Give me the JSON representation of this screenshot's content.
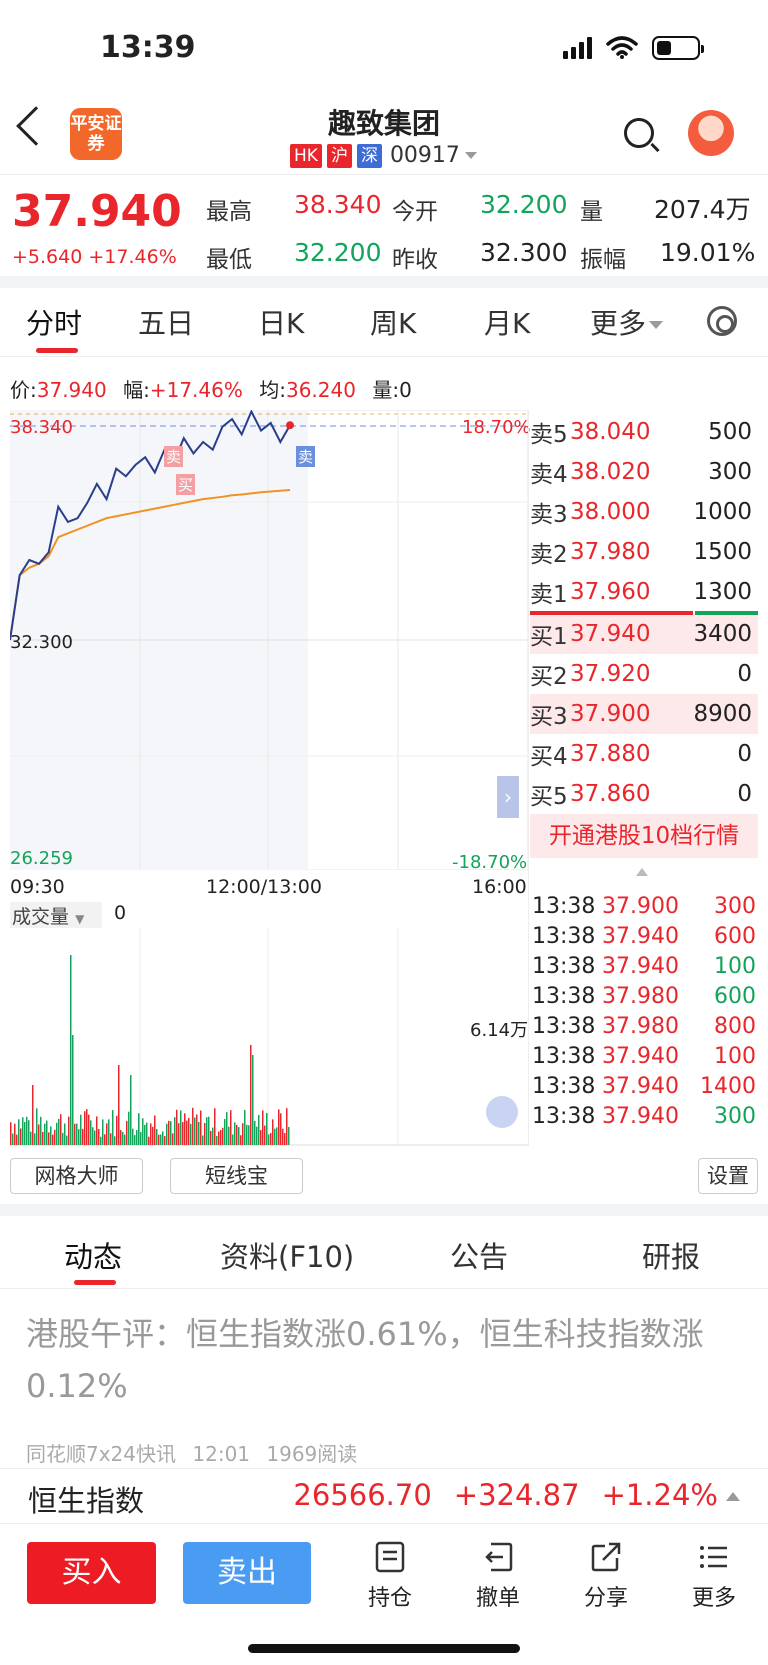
{
  "status": {
    "time": "13:39"
  },
  "header": {
    "logo_text": "平安证券",
    "title": "趣致集团",
    "tags": [
      "HK",
      "沪",
      "深"
    ],
    "code": "00917"
  },
  "quote": {
    "price": "37.940",
    "change": "+5.640",
    "change_pct": "+17.46%",
    "high_label": "最高",
    "high": "38.340",
    "open_label": "今开",
    "open": "32.200",
    "vol_label": "量",
    "vol": "207.4万",
    "low_label": "最低",
    "low": "32.200",
    "prev_close_label": "昨收",
    "prev_close": "32.300",
    "amp_label": "振幅",
    "amp": "19.01%"
  },
  "chart_tabs": [
    "分时",
    "五日",
    "日K",
    "周K",
    "月K",
    "更多"
  ],
  "infoline": {
    "price_label": "价:",
    "price": "37.940",
    "pct_label": "幅:",
    "pct": "+17.46%",
    "avg_label": "均:",
    "avg": "36.240",
    "vol_label": "量:",
    "vol": "0"
  },
  "chart_labels": {
    "top_left": "38.340",
    "top_right": "18.70%",
    "mid_left": "32.300",
    "bottom_left": "26.259",
    "bottom_right": "-18.70%",
    "x_start": "09:30",
    "x_mid": "12:00/13:00",
    "x_end": "16:00",
    "sell_marker": "卖",
    "buy_marker": "买",
    "volume_label": "成交量",
    "volume_value": "0",
    "volume_max": "6.14万"
  },
  "chart_data": {
    "type": "line",
    "x_range": [
      "09:30",
      "16:00"
    ],
    "ylim": [
      26.259,
      38.34
    ],
    "series": [
      {
        "values": [
          32.3,
          34.0,
          34.4,
          34.3,
          34.6,
          35.8,
          35.4,
          35.5,
          35.9,
          36.4,
          36.0,
          36.8,
          36.6,
          36.9,
          37.1,
          36.7,
          37.3,
          37.0,
          37.6,
          37.2,
          37.5,
          37.3,
          37.9,
          38.1,
          37.7,
          38.3,
          37.8,
          38.0,
          37.5,
          37.94
        ]
      },
      {
        "values": [
          32.3,
          34.0,
          34.2,
          34.3,
          34.5,
          35.0,
          35.1,
          35.2,
          35.3,
          35.4,
          35.5,
          35.55,
          35.6,
          35.65,
          35.7,
          35.75,
          35.8,
          35.85,
          35.9,
          35.95,
          36.0,
          36.03,
          36.06,
          36.1,
          36.12,
          36.15,
          36.18,
          36.2,
          36.22,
          36.24
        ]
      }
    ],
    "volume_max": "6.14万"
  },
  "order_book": {
    "asks": [
      {
        "label": "卖5",
        "price": "38.040",
        "vol": "500"
      },
      {
        "label": "卖4",
        "price": "38.020",
        "vol": "300"
      },
      {
        "label": "卖3",
        "price": "38.000",
        "vol": "1000"
      },
      {
        "label": "卖2",
        "price": "37.980",
        "vol": "1500"
      },
      {
        "label": "卖1",
        "price": "37.960",
        "vol": "1300"
      }
    ],
    "bids": [
      {
        "label": "买1",
        "price": "37.940",
        "vol": "3400"
      },
      {
        "label": "买2",
        "price": "37.920",
        "vol": "0"
      },
      {
        "label": "买3",
        "price": "37.900",
        "vol": "8900"
      },
      {
        "label": "买4",
        "price": "37.880",
        "vol": "0"
      },
      {
        "label": "买5",
        "price": "37.860",
        "vol": "0"
      }
    ],
    "promo": "开通港股10档行情"
  },
  "trades": [
    {
      "time": "13:38",
      "price": "37.900",
      "vol": "300",
      "side": "red"
    },
    {
      "time": "13:38",
      "price": "37.940",
      "vol": "600",
      "side": "red"
    },
    {
      "time": "13:38",
      "price": "37.940",
      "vol": "100",
      "side": "green"
    },
    {
      "time": "13:38",
      "price": "37.980",
      "vol": "600",
      "side": "green"
    },
    {
      "time": "13:38",
      "price": "37.980",
      "vol": "800",
      "side": "red"
    },
    {
      "time": "13:38",
      "price": "37.940",
      "vol": "100",
      "side": "red"
    },
    {
      "time": "13:38",
      "price": "37.940",
      "vol": "1400",
      "side": "red"
    },
    {
      "time": "13:38",
      "price": "37.940",
      "vol": "300",
      "side": "green"
    }
  ],
  "tools": {
    "grid_master": "网格大师",
    "short_line": "短线宝",
    "settings": "设置"
  },
  "bottom_tabs": [
    "动态",
    "资料(F10)",
    "公告",
    "研报"
  ],
  "news": {
    "title": "港股午评：恒生指数涨0.61%，恒生科技指数涨0.12%",
    "source": "同花顺7x24快讯",
    "time": "12:01",
    "reads": "1969阅读"
  },
  "index": {
    "name": "恒生指数",
    "value": "26566.70",
    "change": "+324.87",
    "pct": "+1.24%"
  },
  "actions": {
    "buy": "买入",
    "sell": "卖出",
    "position": "持仓",
    "cancel": "撤单",
    "share": "分享",
    "more": "更多"
  },
  "colors": {
    "up": "#e8262b",
    "down": "#14a35a",
    "accent": "#f2682a",
    "sell_button": "#4a9cf2"
  }
}
